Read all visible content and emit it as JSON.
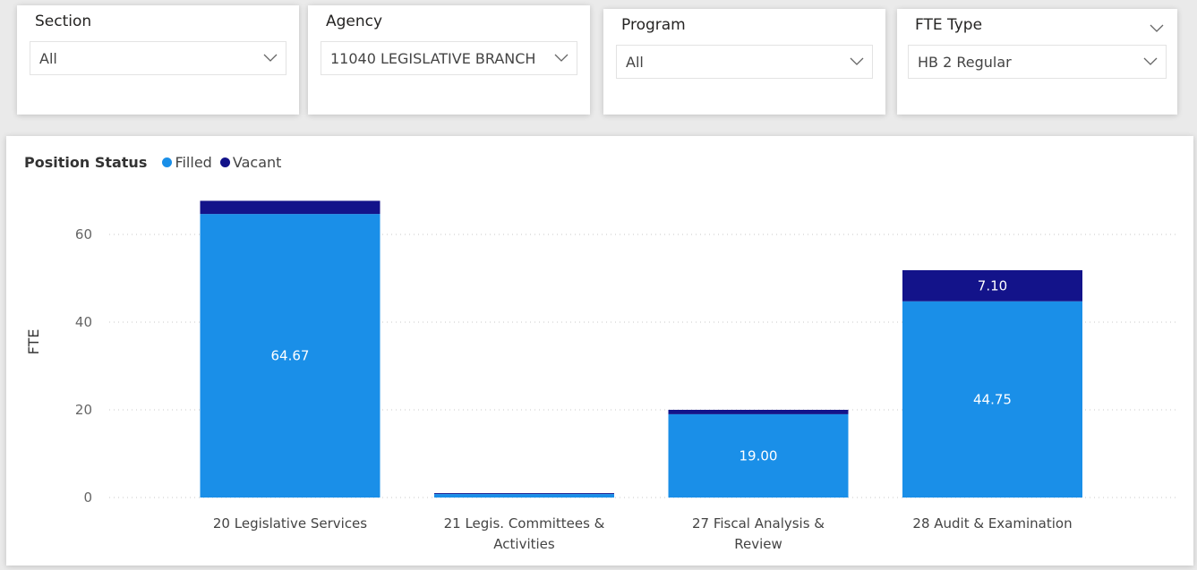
{
  "filters": {
    "section": {
      "label": "Section",
      "value": "All"
    },
    "agency": {
      "label": "Agency",
      "value": "11040 LEGISLATIVE BRANCH"
    },
    "program": {
      "label": "Program",
      "value": "All"
    },
    "fte_type": {
      "label": "FTE Type",
      "value": "HB 2 Regular"
    }
  },
  "chart_data": {
    "type": "bar",
    "stacked": true,
    "legend_title": "Position Status",
    "legend_position": "top-left",
    "ylabel": "FTE",
    "xlabel": "",
    "ylim": [
      0,
      70
    ],
    "yticks": [
      0,
      20,
      40,
      60
    ],
    "grid": true,
    "categories": [
      "20 Legislative Services",
      "21 Legis. Committees & Activities",
      "27 Fiscal Analysis & Review",
      "28 Audit & Examination"
    ],
    "series": [
      {
        "name": "Filled",
        "color": "#1a8fe8",
        "values": [
          64.67,
          0.8,
          19.0,
          44.75
        ],
        "labels": [
          "64.67",
          "",
          "19.00",
          "44.75"
        ]
      },
      {
        "name": "Vacant",
        "color": "#13138a",
        "values": [
          3.0,
          0.2,
          1.0,
          7.1
        ],
        "labels": [
          "",
          "",
          "",
          "7.10"
        ]
      }
    ]
  }
}
